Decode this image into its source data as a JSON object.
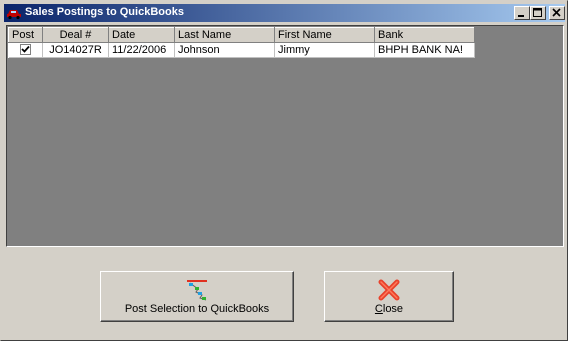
{
  "window": {
    "title": "Sales Postings to QuickBooks",
    "icon": "car-icon",
    "controls": {
      "minimize": "_",
      "maximize": "□",
      "close": "✕"
    }
  },
  "grid": {
    "columns": [
      "Post",
      "Deal #",
      "Date",
      "Last Name",
      "First Name",
      "Bank"
    ],
    "rows": [
      {
        "post": true,
        "deal": "JO14027R",
        "date": "11/22/2006",
        "last_name": "Johnson",
        "first_name": "Jimmy",
        "bank": "BHPH BANK NA!"
      }
    ]
  },
  "buttons": {
    "post_label": "Post Selection to QuickBooks",
    "post_icon": "quickbooks-post-icon",
    "close_label": "Close",
    "close_icon": "red-x-icon"
  },
  "colors": {
    "titlebar_start": "#0a246a",
    "titlebar_end": "#a6caf0",
    "grid_background": "#808080",
    "window_face": "#d4d0c8",
    "close_icon": "#e8412b"
  }
}
